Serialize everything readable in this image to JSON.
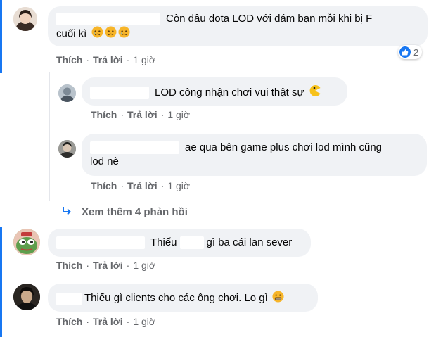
{
  "comments": [
    {
      "text": "Còn đâu dota LOD với đám bạn mỗi khi bị F",
      "text_line2": "cuối kì",
      "emoji": "sad-face",
      "actions": {
        "like": "Thích",
        "reply": "Trả lời",
        "time": "1 giờ"
      },
      "reaction_count": "2",
      "replies": [
        {
          "text": "LOD công nhận chơi vui thật sự",
          "emoji": "pacman",
          "actions": {
            "like": "Thích",
            "reply": "Trả lời",
            "time": "1 giờ"
          }
        },
        {
          "text": "ae qua bên game plus chơi lod mình cũng",
          "text_line2": "lod nè",
          "actions": {
            "like": "Thích",
            "reply": "Trả lời",
            "time": "1 giờ"
          }
        }
      ],
      "more_replies": "Xem thêm 4 phản hồi"
    },
    {
      "text_before": "Thiếu",
      "text_after": "gì ba cái lan sever",
      "actions": {
        "like": "Thích",
        "reply": "Trả lời",
        "time": "1 giờ"
      }
    },
    {
      "text": "Thiếu gì clients cho các ông chơi. Lo gì",
      "emoji": "grimace-face",
      "actions": {
        "like": "Thích",
        "reply": "Trả lời",
        "time": "1 giờ"
      }
    }
  ],
  "colors": {
    "bubble": "#f0f2f5",
    "meta_text": "#65676b",
    "like_blue": "#1877f2",
    "thread_line": "#e4e6eb",
    "left_border": "#1877f2"
  }
}
